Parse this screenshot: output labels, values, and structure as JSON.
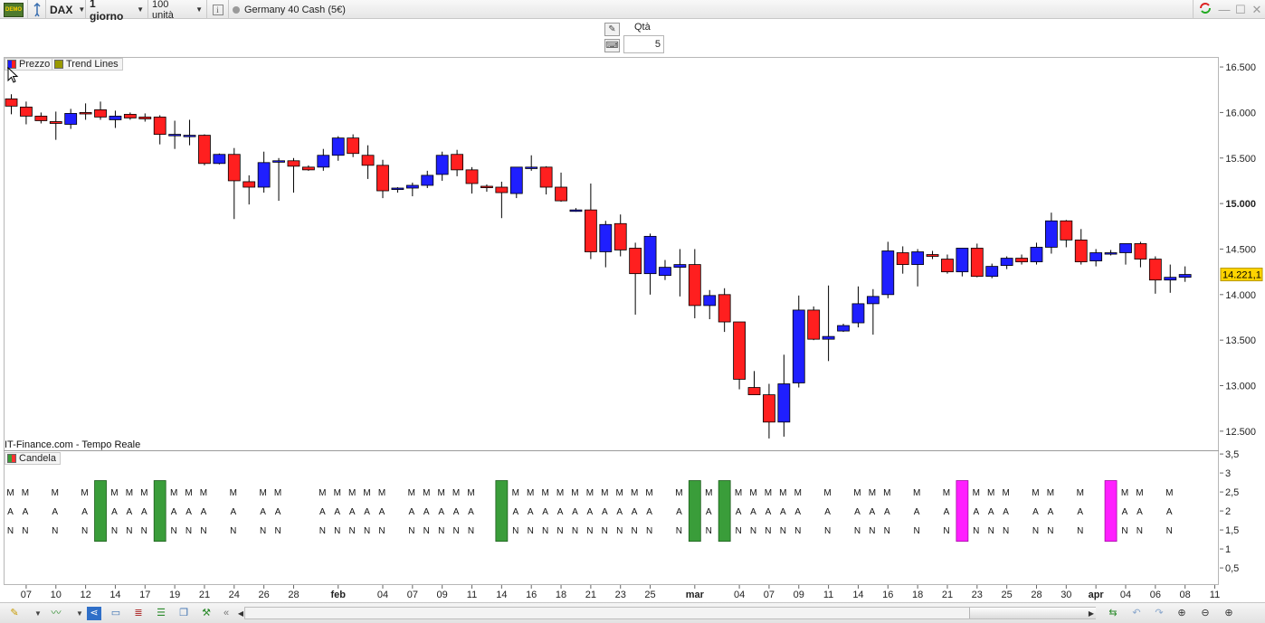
{
  "toolbar": {
    "logo_text": "DEMO",
    "symbol": "DAX",
    "timeframe": "1 giorno",
    "units": "100 unità",
    "instrument": "Germany 40 Cash (5€)"
  },
  "order_panel": {
    "qty_label": "Qtà",
    "qty_value": "5"
  },
  "legends": {
    "price": "Prezzo",
    "trend": "Trend Lines",
    "indicator": "Candela"
  },
  "credit": "IT-Finance.com - Tempo Reale",
  "colors": {
    "up": "#1f1fff",
    "down": "#ff1f1f",
    "green": "#3a9d3a",
    "magenta": "#ff1fff",
    "price_tag": "#ffd400"
  },
  "chart_data": [
    {
      "type": "candlestick",
      "title": "",
      "ylim": [
        12300,
        16600
      ],
      "yticks": [
        {
          "value": 12500,
          "label": "12.500"
        },
        {
          "value": 13000,
          "label": "13.000"
        },
        {
          "value": 13500,
          "label": "13.500"
        },
        {
          "value": 14000,
          "label": "14.000"
        },
        {
          "value": 14500,
          "label": "14.500"
        },
        {
          "value": 15000,
          "label": "15.000",
          "bold": true
        },
        {
          "value": 15500,
          "label": "15.500"
        },
        {
          "value": 16000,
          "label": "16.000"
        },
        {
          "value": 16500,
          "label": "16.500"
        }
      ],
      "last_price": {
        "value": 14221.1,
        "label": "14.221,1"
      },
      "xticks": [
        {
          "i": 1,
          "label": "07"
        },
        {
          "i": 3,
          "label": "10"
        },
        {
          "i": 5,
          "label": "12"
        },
        {
          "i": 7,
          "label": "14"
        },
        {
          "i": 9,
          "label": "17"
        },
        {
          "i": 11,
          "label": "19"
        },
        {
          "i": 13,
          "label": "21"
        },
        {
          "i": 15,
          "label": "24"
        },
        {
          "i": 17,
          "label": "26"
        },
        {
          "i": 19,
          "label": "28"
        },
        {
          "i": 22,
          "label": "feb",
          "bold": true
        },
        {
          "i": 25,
          "label": "04"
        },
        {
          "i": 27,
          "label": "07"
        },
        {
          "i": 29,
          "label": "09"
        },
        {
          "i": 31,
          "label": "11"
        },
        {
          "i": 33,
          "label": "14"
        },
        {
          "i": 35,
          "label": "16"
        },
        {
          "i": 37,
          "label": "18"
        },
        {
          "i": 39,
          "label": "21"
        },
        {
          "i": 41,
          "label": "23"
        },
        {
          "i": 43,
          "label": "25"
        },
        {
          "i": 46,
          "label": "mar",
          "bold": true
        },
        {
          "i": 49,
          "label": "04"
        },
        {
          "i": 51,
          "label": "07"
        },
        {
          "i": 53,
          "label": "09"
        },
        {
          "i": 55,
          "label": "11"
        },
        {
          "i": 57,
          "label": "14"
        },
        {
          "i": 59,
          "label": "16"
        },
        {
          "i": 61,
          "label": "18"
        },
        {
          "i": 63,
          "label": "21"
        },
        {
          "i": 65,
          "label": "23"
        },
        {
          "i": 67,
          "label": "25"
        },
        {
          "i": 69,
          "label": "28"
        },
        {
          "i": 71,
          "label": "30"
        },
        {
          "i": 73,
          "label": "apr",
          "bold": true
        },
        {
          "i": 75,
          "label": "04"
        },
        {
          "i": 77,
          "label": "06"
        },
        {
          "i": 79,
          "label": "08"
        },
        {
          "i": 81,
          "label": "11"
        }
      ],
      "candles": [
        {
          "o": 16150,
          "h": 16200,
          "l": 15980,
          "c": 16070
        },
        {
          "o": 16060,
          "h": 16120,
          "l": 15870,
          "c": 15960
        },
        {
          "o": 15960,
          "h": 16000,
          "l": 15880,
          "c": 15910
        },
        {
          "o": 15900,
          "h": 16010,
          "l": 15700,
          "c": 15880
        },
        {
          "o": 15870,
          "h": 16040,
          "l": 15820,
          "c": 15990
        },
        {
          "o": 16000,
          "h": 16100,
          "l": 15920,
          "c": 15990
        },
        {
          "o": 16030,
          "h": 16120,
          "l": 15920,
          "c": 15950
        },
        {
          "o": 15920,
          "h": 16020,
          "l": 15830,
          "c": 15960
        },
        {
          "o": 15980,
          "h": 16000,
          "l": 15920,
          "c": 15940
        },
        {
          "o": 15950,
          "h": 15990,
          "l": 15900,
          "c": 15930
        },
        {
          "o": 15950,
          "h": 15970,
          "l": 15650,
          "c": 15760
        },
        {
          "o": 15760,
          "h": 15910,
          "l": 15600,
          "c": 15760
        },
        {
          "o": 15750,
          "h": 15920,
          "l": 15640,
          "c": 15750
        },
        {
          "o": 15750,
          "h": 15760,
          "l": 15420,
          "c": 15440
        },
        {
          "o": 15440,
          "h": 15550,
          "l": 15430,
          "c": 15540
        },
        {
          "o": 15540,
          "h": 15610,
          "l": 14830,
          "c": 15250
        },
        {
          "o": 15240,
          "h": 15310,
          "l": 14990,
          "c": 15180
        },
        {
          "o": 15180,
          "h": 15570,
          "l": 15120,
          "c": 15450
        },
        {
          "o": 15460,
          "h": 15500,
          "l": 15030,
          "c": 15470
        },
        {
          "o": 15470,
          "h": 15500,
          "l": 15120,
          "c": 15410
        },
        {
          "o": 15400,
          "h": 15420,
          "l": 15360,
          "c": 15370
        },
        {
          "o": 15400,
          "h": 15600,
          "l": 15360,
          "c": 15530
        },
        {
          "o": 15530,
          "h": 15740,
          "l": 15470,
          "c": 15720
        },
        {
          "o": 15720,
          "h": 15760,
          "l": 15510,
          "c": 15550
        },
        {
          "o": 15530,
          "h": 15640,
          "l": 15270,
          "c": 15420
        },
        {
          "o": 15420,
          "h": 15480,
          "l": 15060,
          "c": 15140
        },
        {
          "o": 15160,
          "h": 15180,
          "l": 15120,
          "c": 15170
        },
        {
          "o": 15170,
          "h": 15230,
          "l": 15080,
          "c": 15200
        },
        {
          "o": 15200,
          "h": 15360,
          "l": 15170,
          "c": 15310
        },
        {
          "o": 15320,
          "h": 15570,
          "l": 15250,
          "c": 15530
        },
        {
          "o": 15540,
          "h": 15590,
          "l": 15300,
          "c": 15370
        },
        {
          "o": 15370,
          "h": 15400,
          "l": 15110,
          "c": 15220
        },
        {
          "o": 15190,
          "h": 15210,
          "l": 15130,
          "c": 15180
        },
        {
          "o": 15180,
          "h": 15240,
          "l": 14840,
          "c": 15120
        },
        {
          "o": 15110,
          "h": 15400,
          "l": 15060,
          "c": 15400
        },
        {
          "o": 15400,
          "h": 15530,
          "l": 15360,
          "c": 15400
        },
        {
          "o": 15400,
          "h": 15410,
          "l": 15100,
          "c": 15180
        },
        {
          "o": 15180,
          "h": 15340,
          "l": 15020,
          "c": 15030
        },
        {
          "o": 14930,
          "h": 14950,
          "l": 14910,
          "c": 14930
        },
        {
          "o": 14930,
          "h": 15220,
          "l": 14390,
          "c": 14470
        },
        {
          "o": 14470,
          "h": 14810,
          "l": 14300,
          "c": 14770
        },
        {
          "o": 14780,
          "h": 14880,
          "l": 14420,
          "c": 14490
        },
        {
          "o": 14510,
          "h": 14570,
          "l": 13780,
          "c": 14230
        },
        {
          "o": 14230,
          "h": 14670,
          "l": 14000,
          "c": 14640
        },
        {
          "o": 14210,
          "h": 14380,
          "l": 14160,
          "c": 14300
        },
        {
          "o": 14300,
          "h": 14500,
          "l": 13980,
          "c": 14330
        },
        {
          "o": 14330,
          "h": 14500,
          "l": 13740,
          "c": 13880
        },
        {
          "o": 13880,
          "h": 14050,
          "l": 13730,
          "c": 13990
        },
        {
          "o": 14000,
          "h": 14070,
          "l": 13590,
          "c": 13700
        },
        {
          "o": 13700,
          "h": 13700,
          "l": 12960,
          "c": 13070
        },
        {
          "o": 12980,
          "h": 13160,
          "l": 12900,
          "c": 12900
        },
        {
          "o": 12900,
          "h": 13020,
          "l": 12420,
          "c": 12600
        },
        {
          "o": 12600,
          "h": 13340,
          "l": 12440,
          "c": 13020
        },
        {
          "o": 13030,
          "h": 13990,
          "l": 12980,
          "c": 13830
        },
        {
          "o": 13830,
          "h": 13870,
          "l": 13500,
          "c": 13510
        },
        {
          "o": 13510,
          "h": 14100,
          "l": 13270,
          "c": 13540
        },
        {
          "o": 13600,
          "h": 13680,
          "l": 13590,
          "c": 13660
        },
        {
          "o": 13690,
          "h": 14090,
          "l": 13640,
          "c": 13900
        },
        {
          "o": 13900,
          "h": 14060,
          "l": 13560,
          "c": 13980
        },
        {
          "o": 14000,
          "h": 14580,
          "l": 13960,
          "c": 14480
        },
        {
          "o": 14460,
          "h": 14530,
          "l": 14230,
          "c": 14330
        },
        {
          "o": 14330,
          "h": 14500,
          "l": 14090,
          "c": 14470
        },
        {
          "o": 14440,
          "h": 14480,
          "l": 14390,
          "c": 14420
        },
        {
          "o": 14390,
          "h": 14440,
          "l": 14230,
          "c": 14250
        },
        {
          "o": 14250,
          "h": 14510,
          "l": 14200,
          "c": 14510
        },
        {
          "o": 14510,
          "h": 14560,
          "l": 14190,
          "c": 14200
        },
        {
          "o": 14200,
          "h": 14340,
          "l": 14180,
          "c": 14310
        },
        {
          "o": 14320,
          "h": 14420,
          "l": 14280,
          "c": 14400
        },
        {
          "o": 14400,
          "h": 14440,
          "l": 14330,
          "c": 14360
        },
        {
          "o": 14360,
          "h": 14570,
          "l": 14330,
          "c": 14520
        },
        {
          "o": 14520,
          "h": 14900,
          "l": 14450,
          "c": 14810
        },
        {
          "o": 14810,
          "h": 14820,
          "l": 14520,
          "c": 14600
        },
        {
          "o": 14600,
          "h": 14720,
          "l": 14330,
          "c": 14360
        },
        {
          "o": 14370,
          "h": 14500,
          "l": 14310,
          "c": 14460
        },
        {
          "o": 14460,
          "h": 14490,
          "l": 14430,
          "c": 14460
        },
        {
          "o": 14460,
          "h": 14560,
          "l": 14330,
          "c": 14560
        },
        {
          "o": 14560,
          "h": 14580,
          "l": 14300,
          "c": 14390
        },
        {
          "o": 14390,
          "h": 14420,
          "l": 14010,
          "c": 14160
        },
        {
          "o": 14160,
          "h": 14330,
          "l": 14020,
          "c": 14190
        },
        {
          "o": 14190,
          "h": 14310,
          "l": 14140,
          "c": 14221
        }
      ]
    },
    {
      "type": "indicator",
      "name": "Candela",
      "ylim": [
        0.05,
        3.55
      ],
      "yticks": [
        {
          "value": 0.5,
          "label": "0,5"
        },
        {
          "value": 1,
          "label": "1"
        },
        {
          "value": 1.5,
          "label": "1,5"
        },
        {
          "value": 2,
          "label": "2"
        },
        {
          "value": 2.5,
          "label": "2,5"
        },
        {
          "value": 3,
          "label": "3"
        },
        {
          "value": 3.5,
          "label": "3,5"
        }
      ],
      "letters": [
        "M",
        "A",
        "N"
      ],
      "letter_cols": [
        0,
        1,
        3,
        5,
        7,
        8,
        9,
        11,
        12,
        13,
        15,
        17,
        18,
        21,
        22,
        23,
        24,
        25,
        27,
        28,
        29,
        30,
        31,
        34,
        35,
        36,
        37,
        38,
        39,
        40,
        41,
        42,
        43,
        45,
        47,
        49,
        50,
        51,
        52,
        53,
        55,
        57,
        58,
        59,
        61,
        63,
        65,
        66,
        67,
        69,
        70,
        72,
        75,
        76,
        78
      ],
      "green_bars": [
        6,
        10,
        33,
        46,
        48
      ],
      "magenta_bars": [
        64,
        74
      ]
    }
  ],
  "bottom_icons": [
    "pen-icon",
    "indicator-icon",
    "share-icon",
    "chat-icon",
    "list-icon",
    "orderbook-icon",
    "windows-icon",
    "tools-icon"
  ]
}
